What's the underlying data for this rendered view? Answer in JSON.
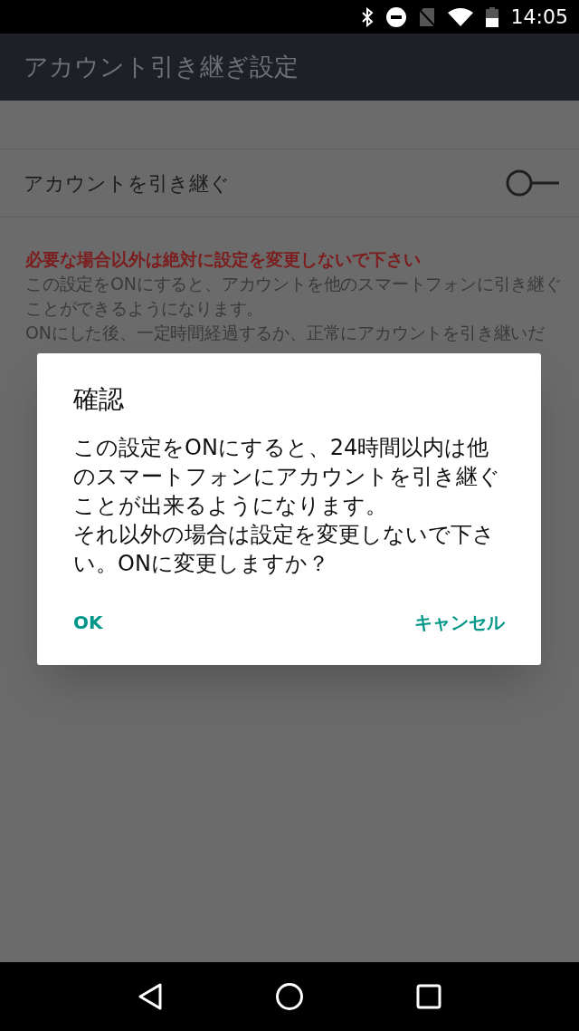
{
  "status_bar": {
    "time": "14:05"
  },
  "app_bar": {
    "title": "アカウント引き継ぎ設定"
  },
  "setting": {
    "label": "アカウントを引き継ぐ",
    "on": false
  },
  "warning": "必要な場合以外は絶対に設定を変更しないで下さい",
  "description": [
    "この設定をONにすると、アカウントを他のスマートフォンに引き継ぐことができるようになります。",
    "ONにした後、一定時間経過するか、正常にアカウントを引き継いだ"
  ],
  "dialog": {
    "title": "確認",
    "message": [
      "この設定をONにすると、24時間以内は他のスマートフォンにアカウントを引き継ぐことが出来るようになります。",
      "それ以外の場合は設定を変更しないで下さい。ONに変更しますか？"
    ],
    "buttons": [
      "OK",
      "キャンセル"
    ]
  }
}
